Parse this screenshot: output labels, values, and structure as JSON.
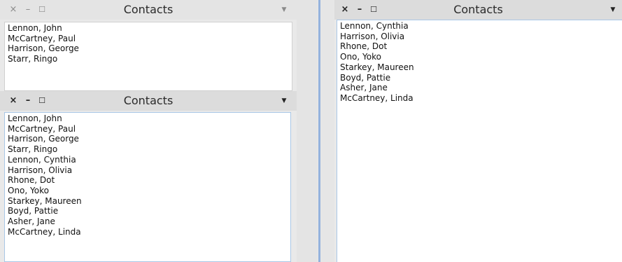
{
  "panels": {
    "top_left": {
      "title": "Contacts",
      "close": "×",
      "minimize": "–",
      "maximize": "☐",
      "menu": "▼",
      "items": [
        "Lennon, John",
        "McCartney, Paul",
        "Harrison, George",
        "Starr, Ringo"
      ]
    },
    "bottom_left": {
      "title": "Contacts",
      "close": "×",
      "minimize": "–",
      "maximize": "☐",
      "menu": "▼",
      "items": [
        "Lennon, John",
        "McCartney, Paul",
        "Harrison, George",
        "Starr, Ringo",
        "Lennon, Cynthia",
        "Harrison, Olivia",
        "Rhone, Dot",
        "Ono, Yoko",
        "Starkey, Maureen",
        "Boyd, Pattie",
        "Asher, Jane",
        "McCartney, Linda"
      ]
    },
    "right": {
      "title": "Contacts",
      "close": "×",
      "minimize": "–",
      "maximize": "☐",
      "menu": "▼",
      "items": [
        "Lennon, Cynthia",
        "Harrison, Olivia",
        "Rhone, Dot",
        "Ono, Yoko",
        "Starkey, Maureen",
        "Boyd, Pattie",
        "Asher, Jane",
        "McCartney, Linda"
      ]
    }
  },
  "colors": {
    "listbox_border": "#a9c7e6",
    "titlebar_bg": "#e6e6e6",
    "accent_divider": "#5b8dd6"
  }
}
